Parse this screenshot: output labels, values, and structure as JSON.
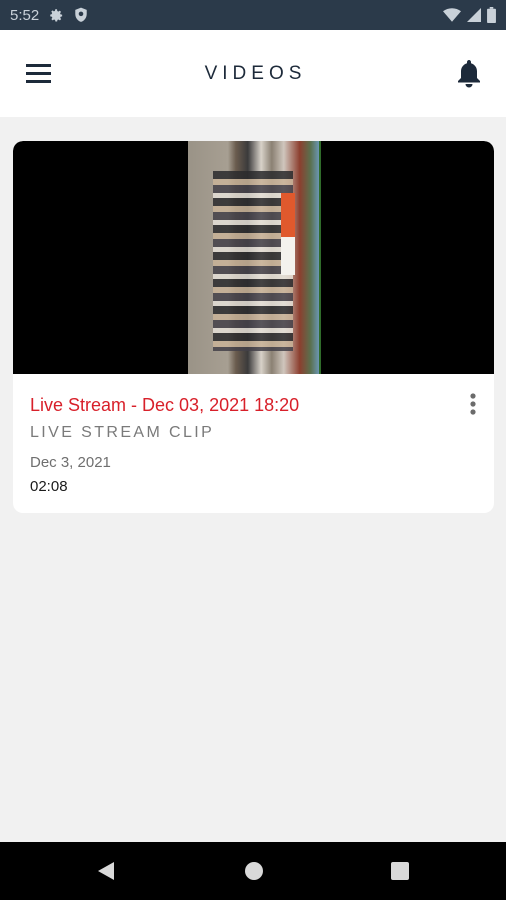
{
  "status_bar": {
    "time": "5:52",
    "icons": [
      "gear-icon",
      "shield-icon",
      "wifi-icon",
      "signal-icon",
      "battery-icon"
    ]
  },
  "header": {
    "title": "VIDEOS",
    "menu_icon": "hamburger-menu-icon",
    "bell_icon": "bell-icon"
  },
  "videos": [
    {
      "title": "Live Stream - Dec 03, 2021 18:20",
      "subtitle": "LIVE STREAM CLIP",
      "date": "Dec 3, 2021",
      "duration": "02:08",
      "more_icon": "more-vertical-icon"
    }
  ],
  "nav_bar": {
    "icons": [
      "back-icon",
      "home-icon",
      "recents-icon"
    ]
  },
  "colors": {
    "status_bar": "#2b3a4a",
    "title_accent": "#d8202a",
    "header_text": "#1d2a3a",
    "background": "#f1f1f1"
  }
}
